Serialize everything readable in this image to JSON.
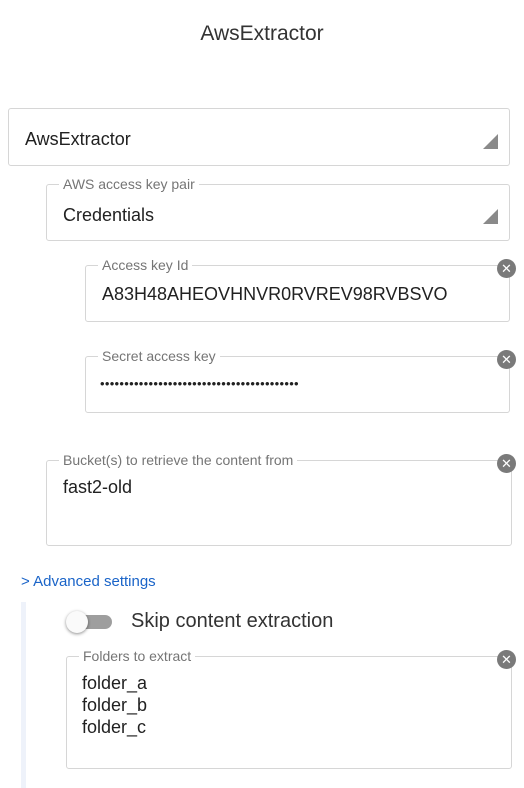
{
  "header": {
    "title": "AwsExtractor"
  },
  "extractor_select": {
    "value": "AwsExtractor"
  },
  "aws_key_pair": {
    "legend": "AWS access key pair",
    "value": "Credentials",
    "access_key_id": {
      "legend": "Access key Id",
      "value": "A83H48AHEOVHNVR0RVREV98RVBSVO"
    },
    "secret_access_key": {
      "legend": "Secret access key",
      "value": "•••••••••••••••••••••••••••••••••••••••••"
    }
  },
  "buckets": {
    "legend": "Bucket(s) to retrieve the content from",
    "value": "fast2-old"
  },
  "advanced": {
    "link_label": "> Advanced settings",
    "skip_extraction": {
      "label": "Skip content extraction",
      "enabled": false
    },
    "folders": {
      "legend": "Folders to extract",
      "items": [
        "folder_a",
        "folder_b",
        "folder_c"
      ]
    }
  },
  "icons": {
    "clear": "clear-circle-icon",
    "dropdown": "dropdown-triangle-icon"
  }
}
